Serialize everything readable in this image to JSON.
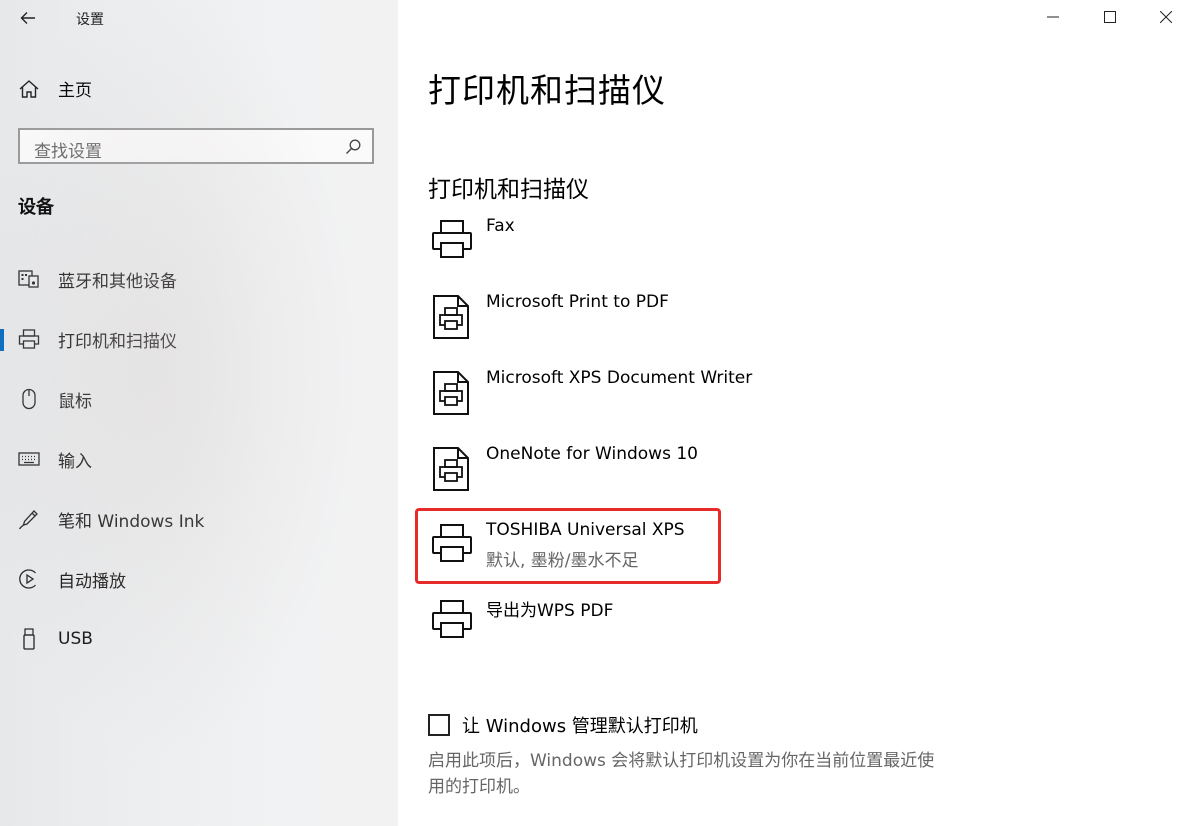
{
  "window": {
    "title": "设置",
    "controls": {
      "minimize": "minimize-icon",
      "maximize": "maximize-icon",
      "close": "close-icon"
    }
  },
  "sidebar": {
    "home_label": "主页",
    "search_placeholder": "查找设置",
    "section_title": "设备",
    "items": [
      {
        "label": "蓝牙和其他设备",
        "icon": "bluetooth-devices-icon"
      },
      {
        "label": "打印机和扫描仪",
        "icon": "printer-icon",
        "active": true
      },
      {
        "label": "鼠标",
        "icon": "mouse-icon"
      },
      {
        "label": "输入",
        "icon": "keyboard-icon"
      },
      {
        "label": "笔和 Windows Ink",
        "icon": "pen-icon"
      },
      {
        "label": "自动播放",
        "icon": "autoplay-icon"
      },
      {
        "label": "USB",
        "icon": "usb-icon"
      }
    ]
  },
  "main": {
    "title": "打印机和扫描仪",
    "section_title": "打印机和扫描仪",
    "printers": [
      {
        "name": "Fax",
        "icon": "printer-icon"
      },
      {
        "name": "Microsoft Print to PDF",
        "icon": "document-printer-icon"
      },
      {
        "name": "Microsoft XPS Document Writer",
        "icon": "document-printer-icon"
      },
      {
        "name": "OneNote for Windows 10",
        "icon": "document-printer-icon"
      },
      {
        "name": "TOSHIBA Universal XPS",
        "status": "默认, 墨粉/墨水不足",
        "icon": "printer-icon",
        "highlighted": true
      },
      {
        "name": "导出为WPS PDF",
        "icon": "printer-icon"
      }
    ],
    "default_printer_checkbox": {
      "label": "让 Windows 管理默认打印机",
      "checked": false
    },
    "description_line1": "启用此项后，Windows 会将默认打印机设置为你在当前位置最近使",
    "description_line2": "用的打印机。"
  },
  "colors": {
    "accent": "#0067c0",
    "highlight_border": "#e62b2b",
    "secondary_text": "#666666"
  }
}
